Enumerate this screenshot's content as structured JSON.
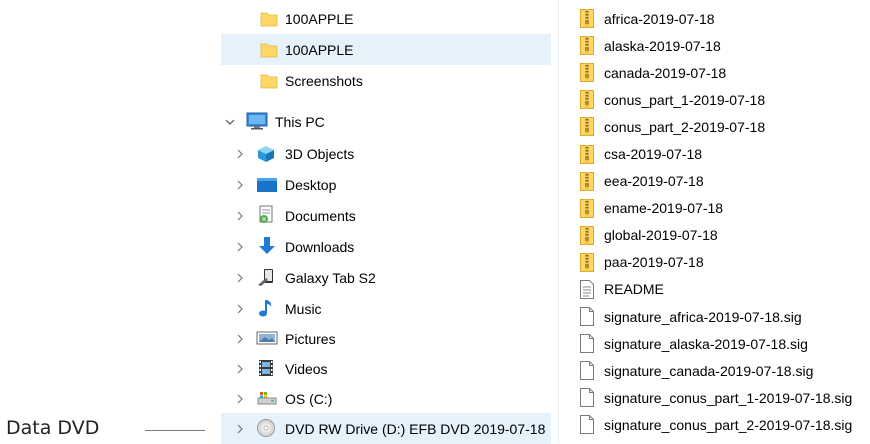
{
  "nav_tree": {
    "folders": [
      {
        "label": "100APPLE",
        "selected": false
      },
      {
        "label": "100APPLE",
        "selected": true
      },
      {
        "label": "Screenshots",
        "selected": false
      }
    ],
    "this_pc": {
      "label": "This PC",
      "expanded": true,
      "icon": "monitor-icon",
      "children": [
        {
          "label": "3D Objects",
          "icon": "cube-icon"
        },
        {
          "label": "Desktop",
          "icon": "desktop-icon"
        },
        {
          "label": "Documents",
          "icon": "documents-icon"
        },
        {
          "label": "Downloads",
          "icon": "download-arrow-icon"
        },
        {
          "label": "Galaxy Tab S2",
          "icon": "tablet-icon"
        },
        {
          "label": "Music",
          "icon": "music-note-icon"
        },
        {
          "label": "Pictures",
          "icon": "pictures-icon"
        },
        {
          "label": "Videos",
          "icon": "film-icon"
        },
        {
          "label": "OS (C:)",
          "icon": "hard-drive-icon"
        },
        {
          "label": "DVD RW Drive (D:) EFB DVD 2019-07-18",
          "icon": "dvd-disc-icon"
        }
      ]
    }
  },
  "file_list": [
    {
      "name": "africa-2019-07-18",
      "type": "zip"
    },
    {
      "name": "alaska-2019-07-18",
      "type": "zip"
    },
    {
      "name": "canada-2019-07-18",
      "type": "zip"
    },
    {
      "name": "conus_part_1-2019-07-18",
      "type": "zip"
    },
    {
      "name": "conus_part_2-2019-07-18",
      "type": "zip"
    },
    {
      "name": "csa-2019-07-18",
      "type": "zip"
    },
    {
      "name": "eea-2019-07-18",
      "type": "zip"
    },
    {
      "name": "ename-2019-07-18",
      "type": "zip"
    },
    {
      "name": "global-2019-07-18",
      "type": "zip"
    },
    {
      "name": "paa-2019-07-18",
      "type": "zip"
    },
    {
      "name": "README",
      "type": "text"
    },
    {
      "name": "signature_africa-2019-07-18.sig",
      "type": "blank"
    },
    {
      "name": "signature_alaska-2019-07-18.sig",
      "type": "blank"
    },
    {
      "name": "signature_canada-2019-07-18.sig",
      "type": "blank"
    },
    {
      "name": "signature_conus_part_1-2019-07-18.sig",
      "type": "blank"
    },
    {
      "name": "signature_conus_part_2-2019-07-18.sig",
      "type": "blank"
    }
  ],
  "annotation": {
    "label": "Data DVD"
  },
  "colors": {
    "selection": "#e5f1fb",
    "folder": "#ffd766",
    "zip_stripe": "#b88a2a"
  }
}
